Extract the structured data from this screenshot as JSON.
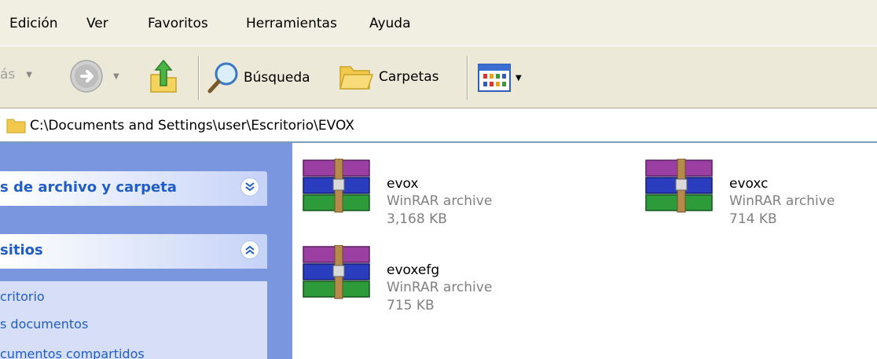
{
  "menubar": {
    "items": [
      "Edición",
      "Ver",
      "Favoritos",
      "Herramientas",
      "Ayuda"
    ]
  },
  "toolbar": {
    "back_label": "ás",
    "search_label": "Búsqueda",
    "folders_label": "Carpetas"
  },
  "address": {
    "path": "C:\\Documents and Settings\\user\\Escritorio\\EVOX"
  },
  "tasks": {
    "file_folder_title": "s de archivo y carpeta",
    "places_title": "sitios",
    "places": [
      "critorio",
      "s documentos",
      "cumentos compartidos"
    ]
  },
  "files": [
    {
      "name": "evox",
      "type": "WinRAR archive",
      "size": "3,168 KB"
    },
    {
      "name": "evoxc",
      "type": "WinRAR archive",
      "size": "714 KB"
    },
    {
      "name": "evoxefg",
      "type": "WinRAR archive",
      "size": "715 KB"
    }
  ],
  "colors": {
    "task_pane_bg": "#7a96df",
    "task_title": "#215dc6",
    "toolbar_bg": "#ece9d8"
  }
}
